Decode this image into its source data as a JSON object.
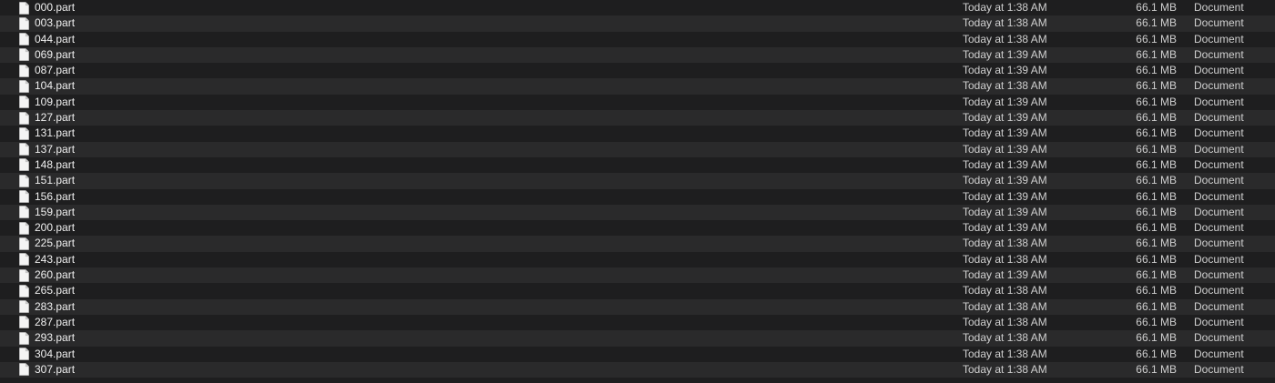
{
  "files": [
    {
      "name": "000.part",
      "date": "Today at 1:38 AM",
      "size": "66.1 MB",
      "kind": "Document"
    },
    {
      "name": "003.part",
      "date": "Today at 1:38 AM",
      "size": "66.1 MB",
      "kind": "Document"
    },
    {
      "name": "044.part",
      "date": "Today at 1:38 AM",
      "size": "66.1 MB",
      "kind": "Document"
    },
    {
      "name": "069.part",
      "date": "Today at 1:39 AM",
      "size": "66.1 MB",
      "kind": "Document"
    },
    {
      "name": "087.part",
      "date": "Today at 1:39 AM",
      "size": "66.1 MB",
      "kind": "Document"
    },
    {
      "name": "104.part",
      "date": "Today at 1:38 AM",
      "size": "66.1 MB",
      "kind": "Document"
    },
    {
      "name": "109.part",
      "date": "Today at 1:39 AM",
      "size": "66.1 MB",
      "kind": "Document"
    },
    {
      "name": "127.part",
      "date": "Today at 1:39 AM",
      "size": "66.1 MB",
      "kind": "Document"
    },
    {
      "name": "131.part",
      "date": "Today at 1:39 AM",
      "size": "66.1 MB",
      "kind": "Document"
    },
    {
      "name": "137.part",
      "date": "Today at 1:39 AM",
      "size": "66.1 MB",
      "kind": "Document"
    },
    {
      "name": "148.part",
      "date": "Today at 1:39 AM",
      "size": "66.1 MB",
      "kind": "Document"
    },
    {
      "name": "151.part",
      "date": "Today at 1:39 AM",
      "size": "66.1 MB",
      "kind": "Document"
    },
    {
      "name": "156.part",
      "date": "Today at 1:39 AM",
      "size": "66.1 MB",
      "kind": "Document"
    },
    {
      "name": "159.part",
      "date": "Today at 1:39 AM",
      "size": "66.1 MB",
      "kind": "Document"
    },
    {
      "name": "200.part",
      "date": "Today at 1:39 AM",
      "size": "66.1 MB",
      "kind": "Document"
    },
    {
      "name": "225.part",
      "date": "Today at 1:38 AM",
      "size": "66.1 MB",
      "kind": "Document"
    },
    {
      "name": "243.part",
      "date": "Today at 1:38 AM",
      "size": "66.1 MB",
      "kind": "Document"
    },
    {
      "name": "260.part",
      "date": "Today at 1:39 AM",
      "size": "66.1 MB",
      "kind": "Document"
    },
    {
      "name": "265.part",
      "date": "Today at 1:38 AM",
      "size": "66.1 MB",
      "kind": "Document"
    },
    {
      "name": "283.part",
      "date": "Today at 1:38 AM",
      "size": "66.1 MB",
      "kind": "Document"
    },
    {
      "name": "287.part",
      "date": "Today at 1:38 AM",
      "size": "66.1 MB",
      "kind": "Document"
    },
    {
      "name": "293.part",
      "date": "Today at 1:38 AM",
      "size": "66.1 MB",
      "kind": "Document"
    },
    {
      "name": "304.part",
      "date": "Today at 1:38 AM",
      "size": "66.1 MB",
      "kind": "Document"
    },
    {
      "name": "307.part",
      "date": "Today at 1:38 AM",
      "size": "66.1 MB",
      "kind": "Document"
    }
  ],
  "icons": {
    "file": "document-icon"
  },
  "colors": {
    "background": "#1e1e1f",
    "row_alt": "#2a2a2b",
    "name_text": "#f0f0f0",
    "meta_text": "#cfcfcf"
  }
}
